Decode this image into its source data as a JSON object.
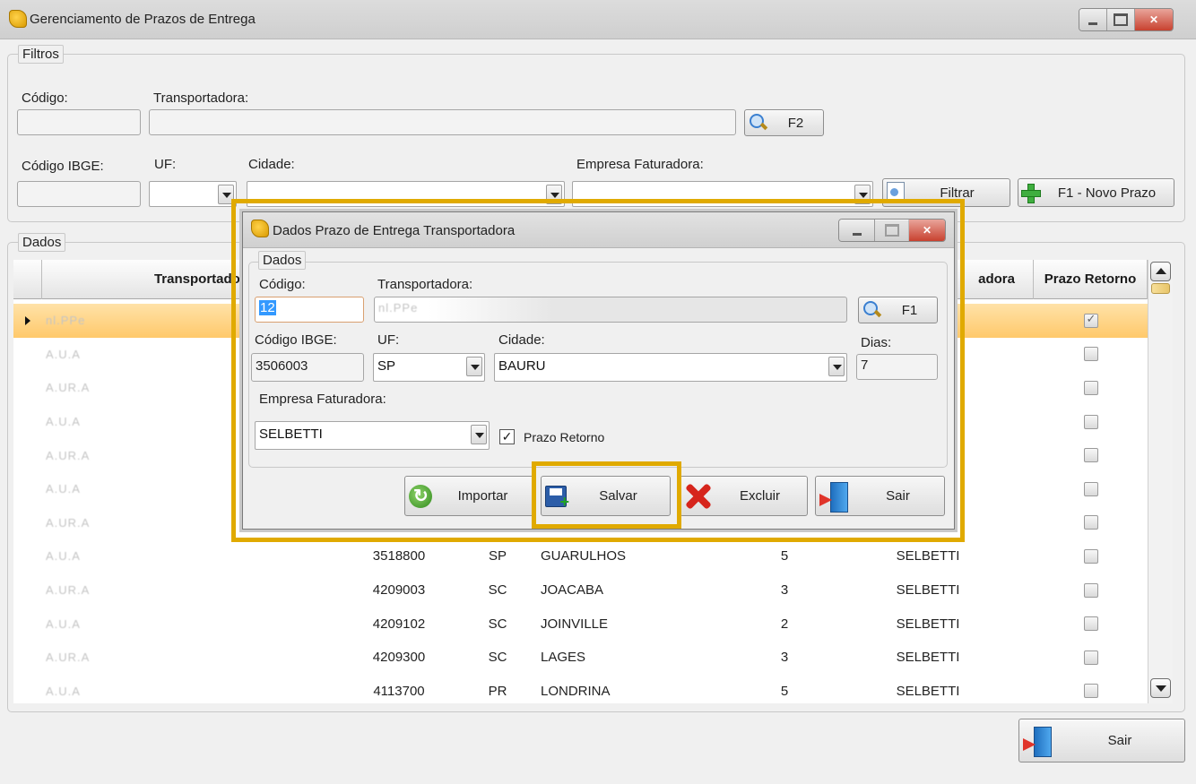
{
  "window": {
    "title": "Gerenciamento de Prazos de Entrega"
  },
  "filters": {
    "group_title": "Filtros",
    "codigo_label": "Código:",
    "codigo_value": "",
    "transportadora_label": "Transportadora:",
    "transportadora_value": "",
    "f2_label": "F2",
    "codigo_ibge_label": "Código IBGE:",
    "codigo_ibge_value": "",
    "uf_label": "UF:",
    "uf_value": "",
    "cidade_label": "Cidade:",
    "cidade_value": "",
    "empresa_label": "Empresa Faturadora:",
    "empresa_value": "",
    "filtrar_label": "Filtrar",
    "novo_prazo_label": "F1 - Novo Prazo"
  },
  "data_group": {
    "title": "Dados",
    "columns": {
      "transportadora": "Transportadora",
      "empresa_partial": "adora",
      "prazo_retorno": "Prazo Retorno"
    },
    "rows": [
      {
        "name": "nl.PPe",
        "ibge": "",
        "uf": "",
        "cidade": "",
        "dias": "",
        "empresa": "",
        "retorno": true,
        "selected": true
      },
      {
        "name": "A.U.A",
        "ibge": "",
        "uf": "",
        "cidade": "",
        "dias": "",
        "empresa": "",
        "retorno": false,
        "selected": false
      },
      {
        "name": "A.UR.A",
        "ibge": "",
        "uf": "",
        "cidade": "",
        "dias": "",
        "empresa": "",
        "retorno": false,
        "selected": false
      },
      {
        "name": "A.U.A",
        "ibge": "",
        "uf": "",
        "cidade": "",
        "dias": "",
        "empresa": "",
        "retorno": false,
        "selected": false
      },
      {
        "name": "A.UR.A",
        "ibge": "",
        "uf": "",
        "cidade": "",
        "dias": "",
        "empresa": "",
        "retorno": false,
        "selected": false
      },
      {
        "name": "A.U.A",
        "ibge": "",
        "uf": "",
        "cidade": "",
        "dias": "",
        "empresa": "",
        "retorno": false,
        "selected": false
      },
      {
        "name": "A.UR.A",
        "ibge": "",
        "uf": "",
        "cidade": "",
        "dias": "",
        "empresa": "",
        "retorno": false,
        "selected": false
      },
      {
        "name": "A.U.A",
        "ibge": "3518800",
        "uf": "SP",
        "cidade": "GUARULHOS",
        "dias": "5",
        "empresa": "SELBETTI",
        "retorno": false,
        "selected": false
      },
      {
        "name": "A.UR.A",
        "ibge": "4209003",
        "uf": "SC",
        "cidade": "JOACABA",
        "dias": "3",
        "empresa": "SELBETTI",
        "retorno": false,
        "selected": false
      },
      {
        "name": "A.U.A",
        "ibge": "4209102",
        "uf": "SC",
        "cidade": "JOINVILLE",
        "dias": "2",
        "empresa": "SELBETTI",
        "retorno": false,
        "selected": false
      },
      {
        "name": "A.UR.A",
        "ibge": "4209300",
        "uf": "SC",
        "cidade": "LAGES",
        "dias": "3",
        "empresa": "SELBETTI",
        "retorno": false,
        "selected": false
      },
      {
        "name": "A.U.A",
        "ibge": "4113700",
        "uf": "PR",
        "cidade": "LONDRINA",
        "dias": "5",
        "empresa": "SELBETTI",
        "retorno": false,
        "selected": false
      }
    ]
  },
  "main_sair_label": "Sair",
  "dialog": {
    "title": "Dados Prazo de Entrega Transportadora",
    "group_title": "Dados",
    "codigo_label": "Código:",
    "codigo_value": "12",
    "transportadora_label": "Transportadora:",
    "transportadora_value": "nl.PPe",
    "f1_label": "F1",
    "codigo_ibge_label": "Código IBGE:",
    "codigo_ibge_value": "3506003",
    "uf_label": "UF:",
    "uf_value": "SP",
    "cidade_label": "Cidade:",
    "cidade_value": "BAURU",
    "dias_label": "Dias:",
    "dias_value": "7",
    "empresa_label": "Empresa Faturadora:",
    "empresa_value": "SELBETTI",
    "prazo_retorno_label": "Prazo Retorno",
    "prazo_retorno_checked": true,
    "importar_label": "Importar",
    "salvar_label": "Salvar",
    "excluir_label": "Excluir",
    "sair_label": "Sair"
  },
  "colors": {
    "highlight": "#e0aa00",
    "selected_row": "#ffc96b",
    "close_button": "#c8412f"
  }
}
